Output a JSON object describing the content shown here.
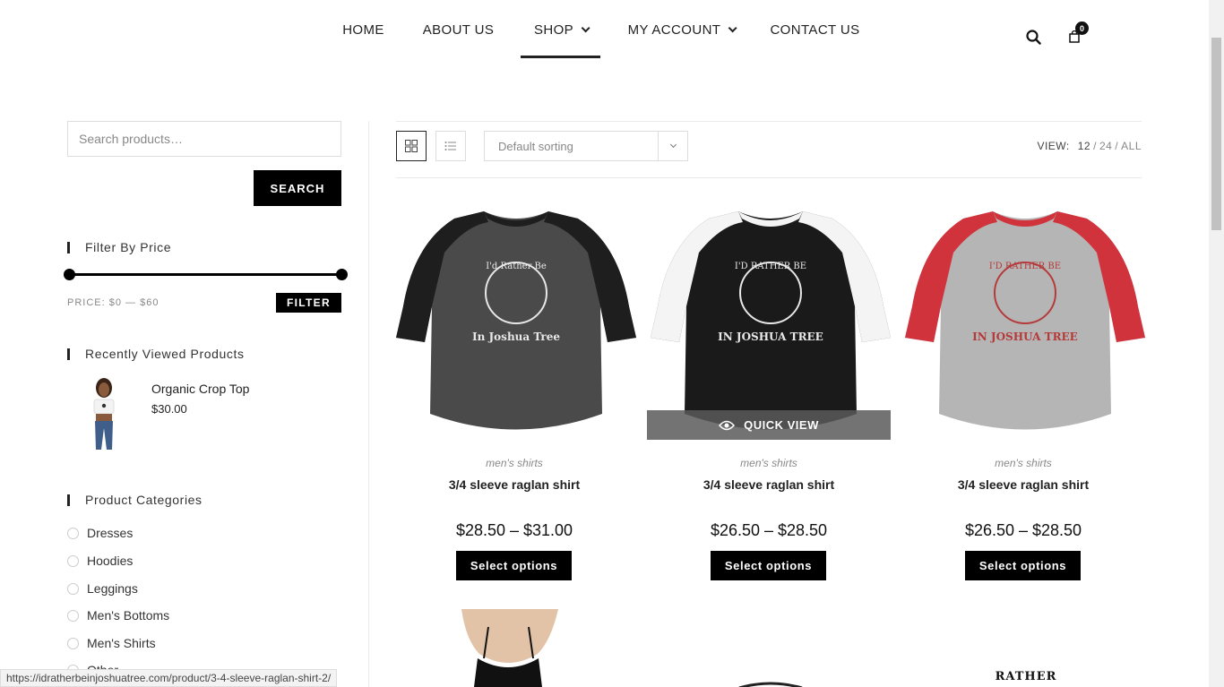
{
  "nav": {
    "items": [
      {
        "label": "HOME"
      },
      {
        "label": "ABOUT US"
      },
      {
        "label": "SHOP",
        "active": true
      },
      {
        "label": "MY ACCOUNT"
      },
      {
        "label": "CONTACT US"
      }
    ],
    "cart_count": "0"
  },
  "sidebar": {
    "search_placeholder": "Search products…",
    "search_button": "SEARCH",
    "filter_title": "Filter By Price",
    "price_label": "PRICE: $0 — $60",
    "filter_button": "FILTER",
    "recent_title": "Recently Viewed Products",
    "recent": {
      "name": "Organic Crop Top",
      "price": "$30.00"
    },
    "categories_title": "Product Categories",
    "categories": [
      "Dresses",
      "Hoodies",
      "Leggings",
      "Men's Bottoms",
      "Men's Shirts",
      "Other"
    ]
  },
  "toolbar": {
    "sort_label": "Default sorting",
    "view_label": "VIEW:",
    "view_options": [
      "12",
      "24",
      "ALL"
    ]
  },
  "products": [
    {
      "category": "men's shirts",
      "name": "3/4 sleeve raglan shirt",
      "price": "$28.50 – $31.00",
      "button": "Select options",
      "body_color": "#4a4a4a",
      "sleeve_color": "#1e1e1e",
      "print_color": "#e8e8e8",
      "print_line1": "I'd Rather Be",
      "print_line2": "In Joshua Tree"
    },
    {
      "category": "men's shirts",
      "name": "3/4 sleeve raglan shirt",
      "price": "$26.50 – $28.50",
      "button": "Select options",
      "body_color": "#1a1a1a",
      "sleeve_color": "#f4f4f4",
      "print_color": "#e8e8e8",
      "print_line1": "I'D RATHER BE",
      "print_line2": "IN JOSHUA TREE"
    },
    {
      "category": "men's shirts",
      "name": "3/4 sleeve raglan shirt",
      "price": "$26.50 – $28.50",
      "button": "Select options",
      "body_color": "#b5b5b5",
      "sleeve_color": "#d0333c",
      "print_color": "#b53a3a",
      "print_line1": "I'D RATHER BE",
      "print_line2": "IN JOSHUA TREE"
    }
  ],
  "quick_view_label": "QUICK VIEW",
  "partial_row": {
    "text3": "RATHER"
  },
  "status_url": "https://idratherbeinjoshuatree.com/product/3-4-sleeve-raglan-shirt-2/"
}
